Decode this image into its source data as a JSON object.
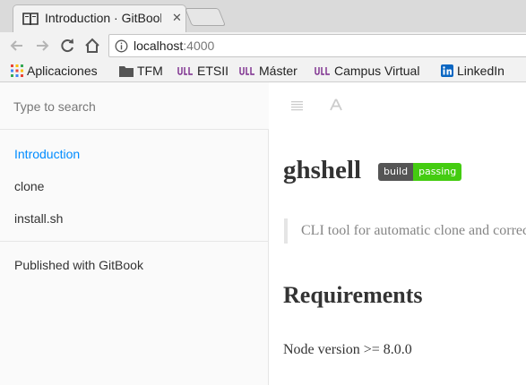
{
  "browser": {
    "tab": {
      "title": "Introduction · GitBook",
      "favicon": "book-icon",
      "close_label": "✕"
    },
    "toolbar": {
      "back": "back-arrow-icon",
      "forward": "forward-arrow-icon",
      "reload": "reload-icon",
      "home": "home-icon"
    },
    "address": {
      "host": "localhost",
      "port": ":4000",
      "security_icon": "info-icon"
    },
    "bookmarks": [
      {
        "label": "Aplicaciones",
        "icon": "apps-grid-icon"
      },
      {
        "label": "TFM",
        "icon": "folder-icon"
      },
      {
        "label": "ETSII",
        "icon": "ull-logo-icon"
      },
      {
        "label": "Máster",
        "icon": "ull-logo-icon"
      },
      {
        "label": "Campus Virtual",
        "icon": "ull-logo-icon"
      },
      {
        "label": "LinkedIn",
        "icon": "linkedin-icon"
      }
    ]
  },
  "sidebar": {
    "search_placeholder": "Type to search",
    "items": [
      {
        "label": "Introduction",
        "active": true
      },
      {
        "label": "clone",
        "active": false
      },
      {
        "label": "install.sh",
        "active": false
      }
    ],
    "footer": "Published with GitBook"
  },
  "content": {
    "title": "ghshell",
    "badge": {
      "left": "build",
      "right": "passing"
    },
    "quote": "CLI tool for automatic clone and correction",
    "section_heading": "Requirements",
    "paragraph": "Node version >= 8.0.0"
  },
  "colors": {
    "accent": "#008cff",
    "badge_pass": "#44cc11",
    "badge_label": "#555555"
  }
}
